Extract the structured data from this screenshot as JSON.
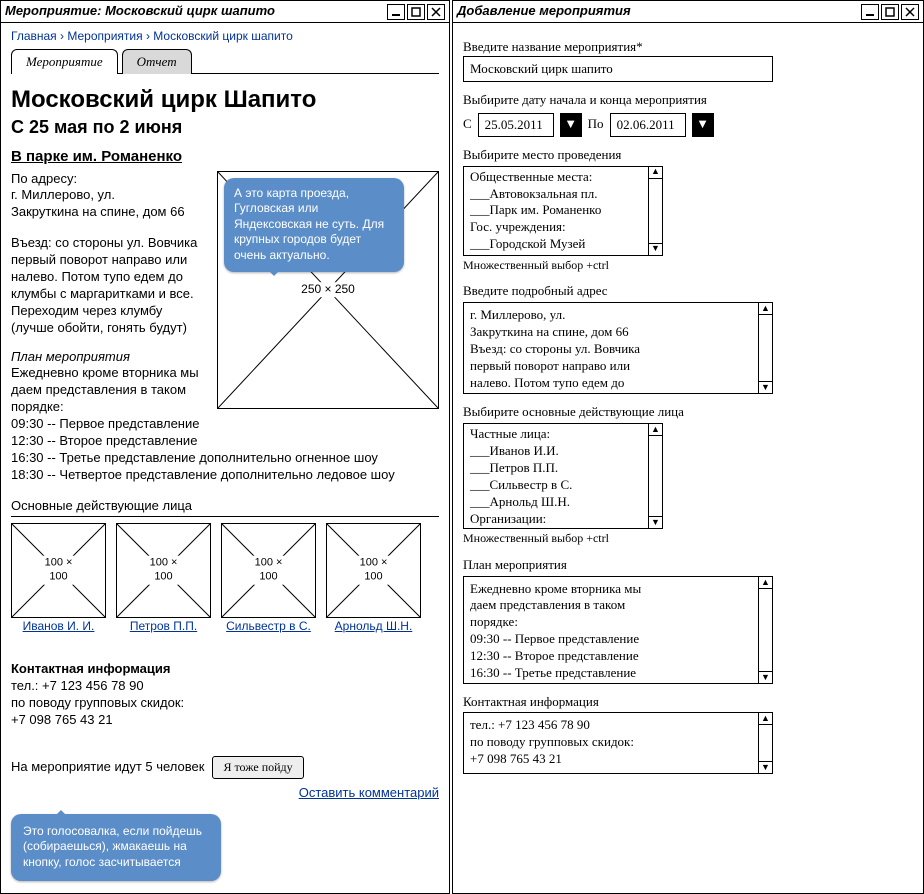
{
  "left": {
    "windowTitle": "Мероприятие: Московский цирк шапито",
    "breadcrumb": {
      "home": "Главная",
      "events": "Мероприятия",
      "current": "Московский цирк шапито",
      "sep": "›"
    },
    "tabs": {
      "event": "Мероприятие",
      "report": "Отчет"
    },
    "title": "Московский цирк Шапито",
    "subtitle": "С 25 мая по 2 июня",
    "parkLink": "В парке им. Романенко",
    "addrLabel": "По адресу:",
    "addr": "г. Миллерово, ул.\nЗакруткина на спине, дом 66",
    "entryLabel": "Въезд: со стороны ул. Вовчика\nпервый поворот направо или\nналево. Потом тупо едем до\nклумбы с маргаритками и все.\nПереходим через клумбу\n(лучше обойти, гонять будут)",
    "mapPlaceholder": "250 × 250",
    "mapBubble": "А это карта проезда, Гугловская или Яндексовская не суть. Для крупных городов будет очень актуально.",
    "planTitle": "План мероприятия",
    "planText": "Ежедневно кроме вторника мы\nдаем представления в таком\nпорядке:\n09:30 -- Первое представление\n12:30 -- Второе представление",
    "planExtra1": "16:30 -- Третье представление дополнительно огненное шоу",
    "planExtra2": "18:30 -- Четвертое представление дополнительно ледовое шоу",
    "actorsTitle": "Основные действующие лица",
    "thumbLabel": "100 × 100",
    "actors": [
      "Иванов И. И.",
      "Петров П.П.",
      "Сильвестр в С.",
      "Арнольд Ш.Н."
    ],
    "contactTitle": "Контактная информация",
    "contactText": "тел.: +7 123 456 78 90\nпо поводу групповых скидок:\n+7 098 765 43 21",
    "goingText": "На мероприятие идут 5 человек",
    "goingBtn": "Я тоже пойду",
    "commentLink": "Оставить комментарий",
    "voteBubble": "Это голосовалка, если пойдешь (собираешься), жмакаешь на кнопку, голос засчитывается"
  },
  "right": {
    "windowTitle": "Добавление мероприятия",
    "nameLabel": "Введите название мероприятия*",
    "nameValue": "Московский цирк шапито",
    "dateLabel": "Выбирите дату начала и конца мероприятия",
    "from": "С",
    "to": "По",
    "dateFrom": "25.05.2011",
    "dateTo": "02.06.2011",
    "venueLabel": "Выбирите место проведения",
    "venueList": "Общественные места:\n___Автовокзальная пл.\n___Парк им. Романенко\nГос. учреждения:\n___Городской Музей",
    "multiHint": "Множественный выбор +ctrl",
    "addrDetailLabel": "Введите подробный адрес",
    "addrDetailValue": "г. Миллерово, ул.\nЗакруткина на спине, дом 66\nВъезд: со стороны ул. Вовчика\nпервый поворот направо или\nналево. Потом тупо едем до",
    "actorsLabel": "Выбирите основные действующие лица",
    "actorsList": "Частные лица:\n___Иванов И.И.\n___Петров П.П.\n___Сильвестр в С.\n___Арнольд Ш.Н.\nОрганизации:",
    "planLabel": "План мероприятия",
    "planValue": "Ежедневно кроме вторника мы\nдаем представления в таком\nпорядке:\n09:30 -- Первое представление\n12:30 -- Второе представление\n16:30 -- Третье представление",
    "contactLabel": "Контактная информация",
    "contactValue": "тел.: +7 123 456 78 90\nпо поводу групповых скидок:\n+7 098 765 43 21"
  }
}
